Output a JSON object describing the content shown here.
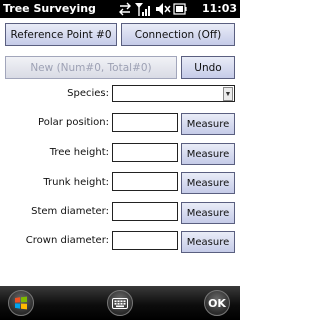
{
  "window": {
    "title": "Tree Surveying",
    "time": "11:03",
    "status_icons": [
      "connectivity-icon",
      "signal-icon",
      "volume-muted-icon",
      "battery-icon"
    ]
  },
  "toolbar": {
    "reference_button": "Reference Point #0",
    "connection_button": "Connection (Off)",
    "new_button": "New (Num#0, Total#0)",
    "undo_button": "Undo"
  },
  "form": {
    "species_label": "Species:",
    "species_value": "",
    "polar_label": "Polar position:",
    "tree_height_label": "Tree height:",
    "trunk_height_label": "Trunk height:",
    "stem_diameter_label": "Stem diameter:",
    "crown_diameter_label": "Crown diameter:",
    "measure_label": "Measure"
  },
  "softkeys": {
    "ok_label": "OK",
    "left_icon": "windows-start-icon",
    "center_icon": "keyboard-icon"
  }
}
